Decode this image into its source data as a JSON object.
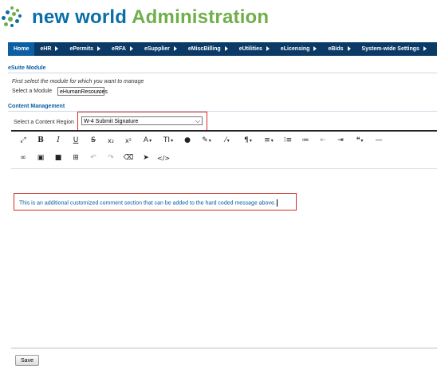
{
  "brand": {
    "name": "new world",
    "suffix": "Administration",
    "colors": {
      "primary": "#0a6fa8",
      "secondary": "#6fae48"
    }
  },
  "nav": {
    "items": [
      {
        "label": "Home",
        "has_arrow": false,
        "active": true
      },
      {
        "label": "eHR",
        "has_arrow": true
      },
      {
        "label": "ePermits",
        "has_arrow": true
      },
      {
        "label": "eRFA",
        "has_arrow": true
      },
      {
        "label": "eSupplier",
        "has_arrow": true
      },
      {
        "label": "eMiscBilling",
        "has_arrow": true
      },
      {
        "label": "eUtilities",
        "has_arrow": true
      },
      {
        "label": "eLicensing",
        "has_arrow": true
      },
      {
        "label": "eBids",
        "has_arrow": true
      },
      {
        "label": "System-wide Settings",
        "has_arrow": true
      }
    ],
    "colors": {
      "background": "#0b3a67",
      "active": "#0d5fa3"
    }
  },
  "module_section": {
    "title": "eSuite Module",
    "hint": "First select the module for which you want to manage",
    "select_label": "Select a Module",
    "selected_value": "eHumanResources"
  },
  "content_section": {
    "title": "Content Management",
    "region_label": "Select a Content Region",
    "region_value": "W-4 Submit Signature"
  },
  "editor": {
    "toolbar_icons_row1": [
      "expand-icon",
      "bold-icon",
      "italic-icon",
      "underline-icon",
      "strikethrough-icon",
      "subscript-icon",
      "superscript-icon",
      "font-size-icon",
      "text-height-icon",
      "color-icon",
      "brush-icon",
      "highlight-icon",
      "paragraph-icon",
      "align-icon",
      "ordered-list-icon",
      "unordered-list-icon",
      "indent-icon",
      "outdent-icon",
      "quote-icon",
      "horizontal-rule-icon"
    ],
    "toolbar_icons_row2": [
      "link-icon",
      "image-icon",
      "video-icon",
      "table-icon",
      "undo-icon",
      "redo-icon",
      "eraser-icon",
      "select-icon",
      "code-view-icon"
    ],
    "content": "This is an additional customized comment section that can be added to the hard coded message above."
  },
  "actions": {
    "save_label": "Save"
  },
  "highlight_color": "#d0302a"
}
